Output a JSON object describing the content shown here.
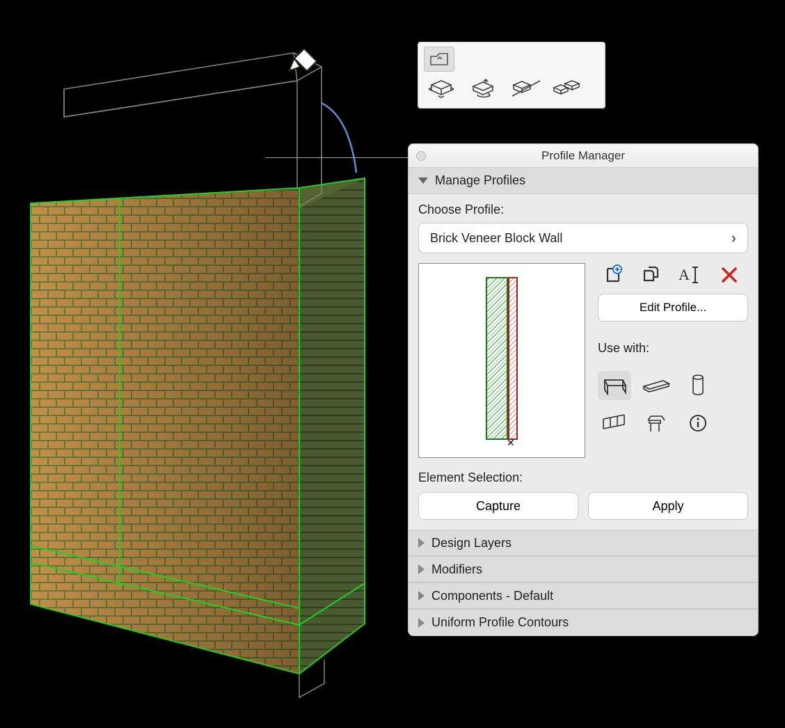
{
  "palette": {
    "title": "Profile Manager",
    "sections": {
      "manage": {
        "label": "Manage Profiles",
        "open": true
      },
      "design_layers": {
        "label": "Design Layers",
        "open": false
      },
      "modifiers": {
        "label": "Modifiers",
        "open": false
      },
      "components": {
        "label": "Components - Default",
        "open": false
      },
      "contours": {
        "label": "Uniform Profile Contours",
        "open": false
      }
    },
    "choose_label": "Choose Profile:",
    "profile_name": "Brick Veneer Block Wall",
    "edit_button": "Edit Profile...",
    "use_with_label": "Use with:",
    "element_selection_label": "Element Selection:",
    "capture_button": "Capture",
    "apply_button": "Apply",
    "action_icons": {
      "new": "new-profile",
      "duplicate": "duplicate-profile",
      "rename": "rename-profile",
      "delete": "delete-profile"
    },
    "use_with": {
      "wall": {
        "selected": true
      },
      "beam": {
        "selected": false
      },
      "column": {
        "selected": false
      },
      "railing": {
        "selected": false
      },
      "object": {
        "selected": false
      },
      "info": {
        "selected": false
      }
    }
  },
  "pet_palette": {
    "tools": [
      "move-3d",
      "rotate-3d",
      "mirror-3d",
      "multiply-3d"
    ]
  },
  "viewport": {
    "cursor": "pencil-tool",
    "element": "Brick wall (selected, profile editing)"
  }
}
